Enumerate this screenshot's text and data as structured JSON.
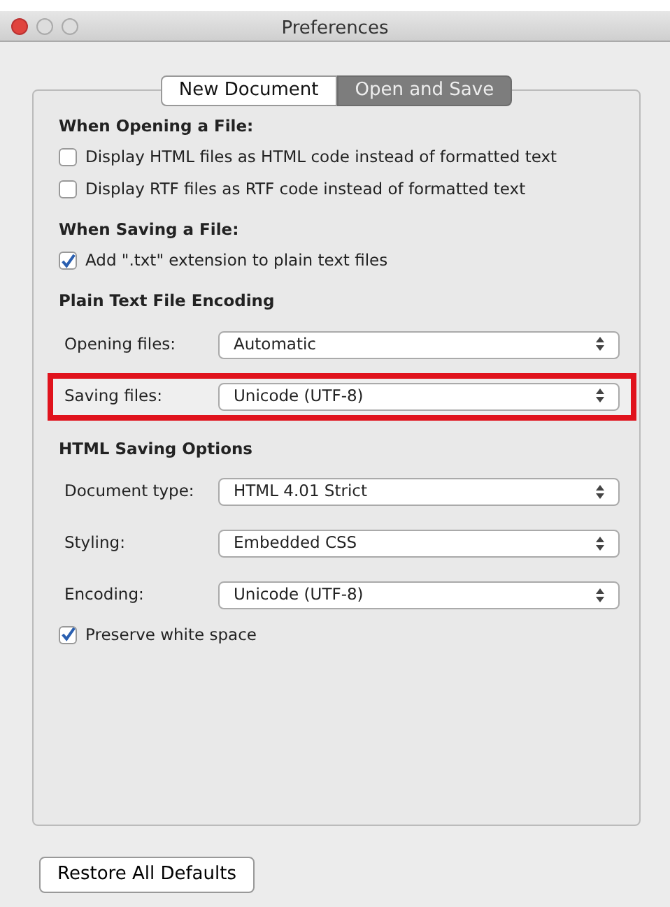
{
  "window": {
    "title": "Preferences"
  },
  "tabs": [
    {
      "label": "New Document",
      "selected": false
    },
    {
      "label": "Open and Save",
      "selected": true
    }
  ],
  "sections": [
    {
      "heading": "When Opening a File:",
      "items": [
        {
          "kind": "checkbox",
          "label": "Display HTML files as HTML code instead of formatted text",
          "checked": false
        },
        {
          "kind": "checkbox",
          "label": "Display RTF files as RTF code instead of formatted text",
          "checked": false
        }
      ]
    },
    {
      "heading": "When Saving a File:",
      "items": [
        {
          "kind": "checkbox",
          "label": "Add \".txt\" extension to plain text files",
          "checked": true
        }
      ]
    },
    {
      "heading": "Plain Text File Encoding",
      "items": [
        {
          "kind": "select",
          "label": "Opening files:",
          "value": "Automatic",
          "highlighted": false
        },
        {
          "kind": "select",
          "label": "Saving files:",
          "value": "Unicode (UTF-8)",
          "highlighted": true
        }
      ]
    },
    {
      "heading": "HTML Saving Options",
      "items": [
        {
          "kind": "select",
          "label": "Document type:",
          "value": "HTML 4.01 Strict",
          "highlighted": false
        },
        {
          "kind": "select",
          "label": "Styling:",
          "value": "Embedded CSS",
          "highlighted": false
        },
        {
          "kind": "select",
          "label": "Encoding:",
          "value": "Unicode (UTF-8)",
          "highlighted": false
        },
        {
          "kind": "checkbox",
          "label": "Preserve white space",
          "checked": true
        }
      ]
    }
  ],
  "buttons": [
    "Restore All Defaults"
  ]
}
